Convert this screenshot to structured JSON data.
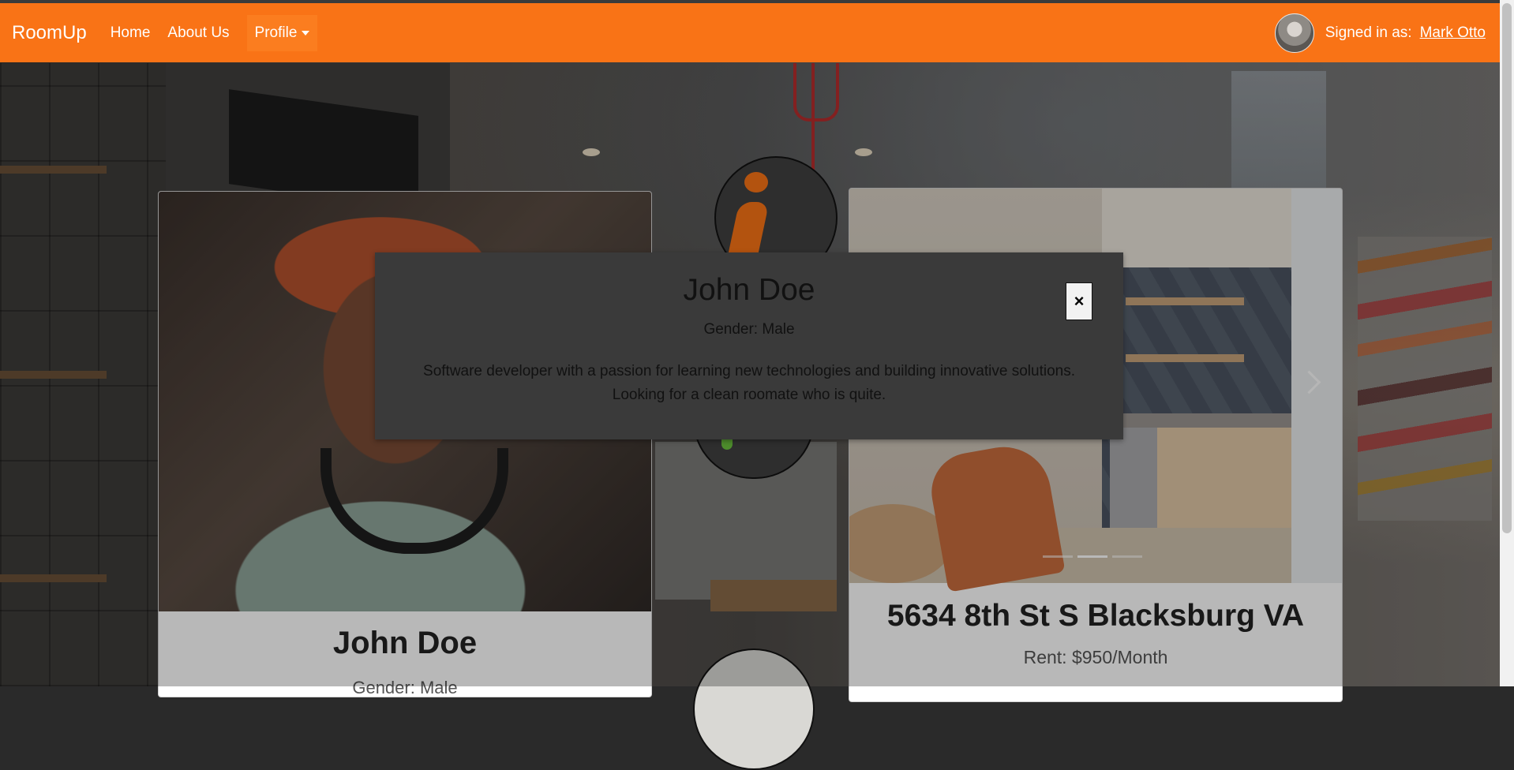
{
  "navbar": {
    "brand": "RoomUp",
    "links": [
      "Home",
      "About Us"
    ],
    "dropdown_label": "Profile",
    "signed_in_label": "Signed in as:",
    "user_name": "Mark Otto",
    "accent_color": "#f97316"
  },
  "profile_card": {
    "name": "John Doe",
    "gender": "Gender: Male"
  },
  "listing_card": {
    "address": "5634 8th St S Blacksburg VA",
    "rent": "Rent: $950/Month",
    "carousel": {
      "slides": 3,
      "active_index": 1
    }
  },
  "modal": {
    "name": "John Doe",
    "gender": "Gender: Male",
    "bio": "Software developer with a passion for learning new technologies and building innovative solutions. Looking for a clean roomate who is quite.",
    "close_label": "×"
  },
  "icons": {
    "info": "info-icon",
    "next": "chevron-right-icon"
  }
}
